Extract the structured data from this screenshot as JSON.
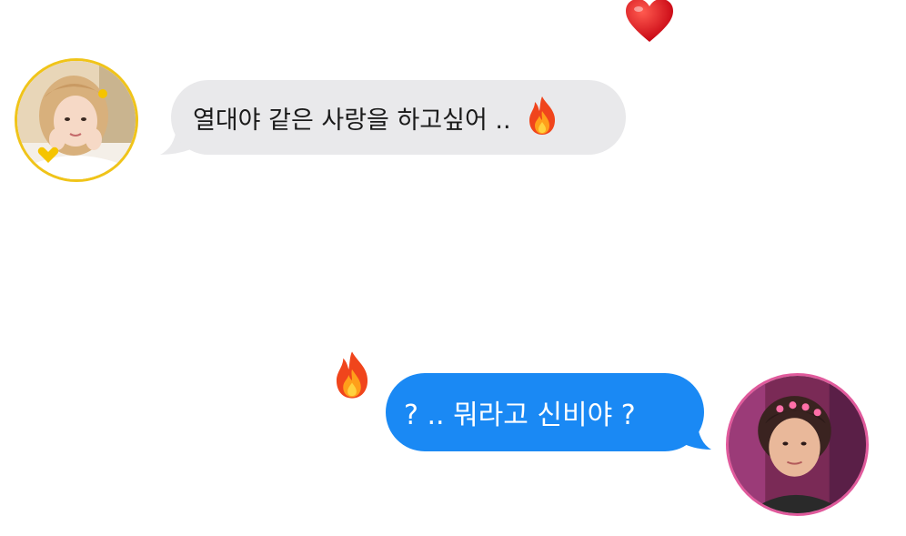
{
  "conversation": {
    "received": {
      "text": "열대야 같은 사랑을 하고싶어 ..",
      "emoji": "fire-icon",
      "bubble_color": "#e9e9eb"
    },
    "sent": {
      "text": "? .. 뭐라고 신비야 ?",
      "bubble_color": "#1a89f4"
    }
  },
  "avatars": {
    "left_border_color": "#f0c419",
    "right_border_color": "#e05a9c"
  },
  "decorations": [
    "heart-icon",
    "fire-icon"
  ]
}
